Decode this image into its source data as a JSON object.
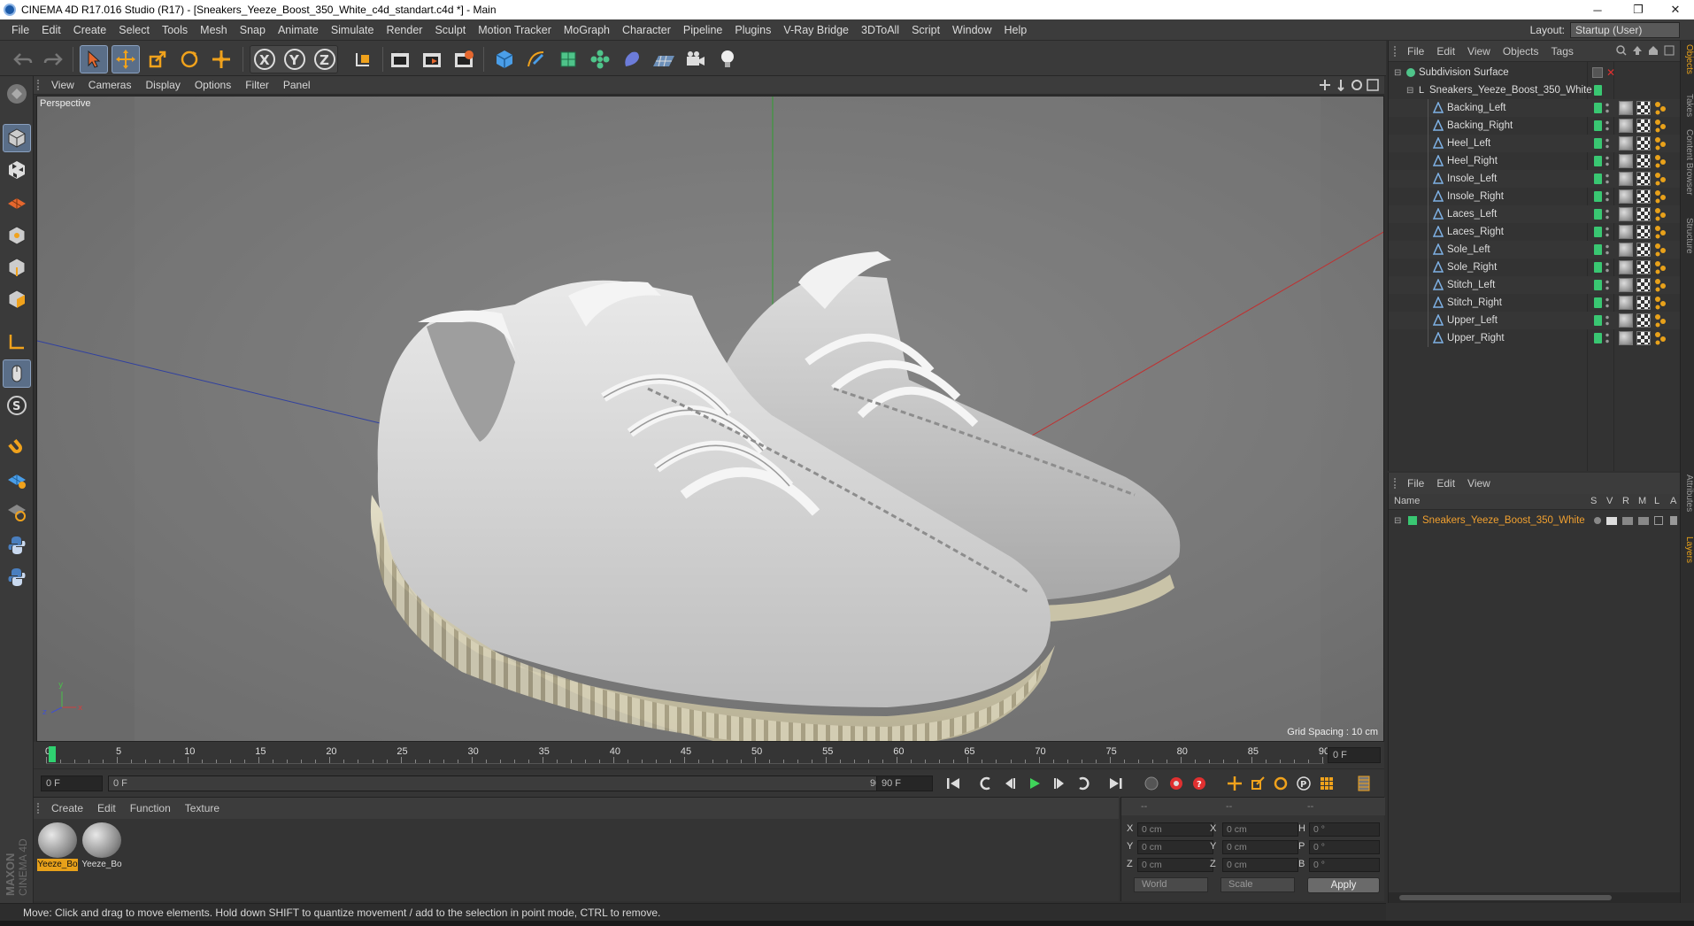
{
  "titlebar": {
    "title": "CINEMA 4D R17.016 Studio (R17) - [Sneakers_Yeeze_Boost_350_White_c4d_standart.c4d *] - Main",
    "minimize": "─",
    "restore": "❐",
    "close": "✕"
  },
  "menubar": {
    "items": [
      "File",
      "Edit",
      "Create",
      "Select",
      "Tools",
      "Mesh",
      "Snap",
      "Animate",
      "Simulate",
      "Render",
      "Sculpt",
      "Motion Tracker",
      "MoGraph",
      "Character",
      "Pipeline",
      "Plugins",
      "V-Ray Bridge",
      "3DToAll",
      "Script",
      "Window",
      "Help"
    ]
  },
  "layout": {
    "label": "Layout:",
    "value": "Startup (User)"
  },
  "viewport": {
    "menu": [
      "View",
      "Cameras",
      "Display",
      "Options",
      "Filter",
      "Panel"
    ],
    "label": "Perspective",
    "grid_spacing": "Grid Spacing : 10 cm"
  },
  "timeline": {
    "ticks": [
      "0",
      "5",
      "10",
      "15",
      "20",
      "25",
      "30",
      "35",
      "40",
      "45",
      "50",
      "55",
      "60",
      "65",
      "70",
      "75",
      "80",
      "85",
      "90"
    ],
    "current_frame": "0 F",
    "start_field": "0 F",
    "range_start": "0 F",
    "range_end": "90 F",
    "end_field": "90 F"
  },
  "material_manager": {
    "menu": [
      "Create",
      "Edit",
      "Function",
      "Texture"
    ],
    "materials": [
      {
        "name": "Yeeze_Bo",
        "active": true
      },
      {
        "name": "Yeeze_Bo",
        "active": false
      }
    ]
  },
  "coords": {
    "headers": [
      "--",
      "--",
      "--"
    ],
    "rows": [
      {
        "a": "X",
        "av": "0 cm",
        "b": "X",
        "bv": "0 cm",
        "c": "H",
        "cv": "0 °"
      },
      {
        "a": "Y",
        "av": "0 cm",
        "b": "Y",
        "bv": "0 cm",
        "c": "P",
        "cv": "0 °"
      },
      {
        "a": "Z",
        "av": "0 cm",
        "b": "Z",
        "bv": "0 cm",
        "c": "B",
        "cv": "0 °"
      }
    ],
    "world": "World",
    "scale": "Scale",
    "apply": "Apply"
  },
  "status": "Move: Click and drag to move elements. Hold down SHIFT to quantize movement / add to the selection in point mode, CTRL to remove.",
  "object_manager": {
    "menu": [
      "File",
      "Edit",
      "View",
      "Objects",
      "Tags"
    ],
    "root": "Subdivision Surface",
    "group": "Sneakers_Yeeze_Boost_350_White",
    "children": [
      "Backing_Left",
      "Backing_Right",
      "Heel_Left",
      "Heel_Right",
      "Insole_Left",
      "Insole_Right",
      "Laces_Left",
      "Laces_Right",
      "Sole_Left",
      "Sole_Right",
      "Stitch_Left",
      "Stitch_Right",
      "Upper_Left",
      "Upper_Right"
    ]
  },
  "layer_manager": {
    "menu": [
      "File",
      "Edit",
      "View"
    ],
    "name_header": "Name",
    "flags": [
      "S",
      "V",
      "R",
      "M",
      "L",
      "A"
    ],
    "layer": "Sneakers_Yeeze_Boost_350_White"
  },
  "right_tabs": [
    "Objects",
    "Takes",
    "Content Browser",
    "Structure",
    "Attributes",
    "Layers"
  ],
  "brand": "MAXON CINEMA 4D",
  "colors": {
    "accent": "#e8a11a",
    "layer_name": "#f0a030",
    "check_green": "#39c772",
    "axis_x": "#c03030",
    "axis_y": "#30a030",
    "axis_z": "#3040a0"
  }
}
